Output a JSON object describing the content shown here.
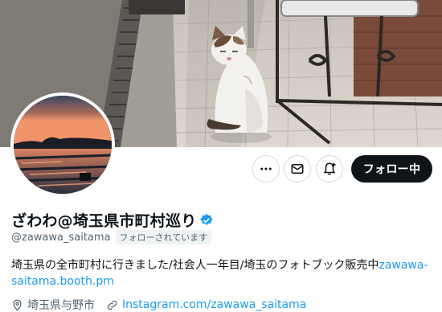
{
  "profile": {
    "display_name": "ざわわ@埼玉県市町村巡り",
    "handle": "@zawawa_saitama",
    "follows_you_badge": "フォローされています",
    "bio_text": "埼玉県の全市町村に行きました/社会人一年目/埼玉のフォトブック販売中",
    "bio_link_line1": "zawawa-",
    "bio_link_line2": "saitama.booth.pm",
    "location": "埼玉県与野市",
    "website": "Instagram.com/zawawa_saitama",
    "verified": true
  },
  "actions": {
    "more_icon": "more-horizontal-icon",
    "message_icon": "mail-icon",
    "notify_icon": "bell-plus-icon",
    "follow_label": "フォロー中"
  },
  "icons": {
    "location": "location-pin-icon",
    "website": "link-icon"
  },
  "colors": {
    "accent": "#1d9bf0",
    "follow_button_bg": "#0f1419",
    "muted_text": "#536471"
  }
}
